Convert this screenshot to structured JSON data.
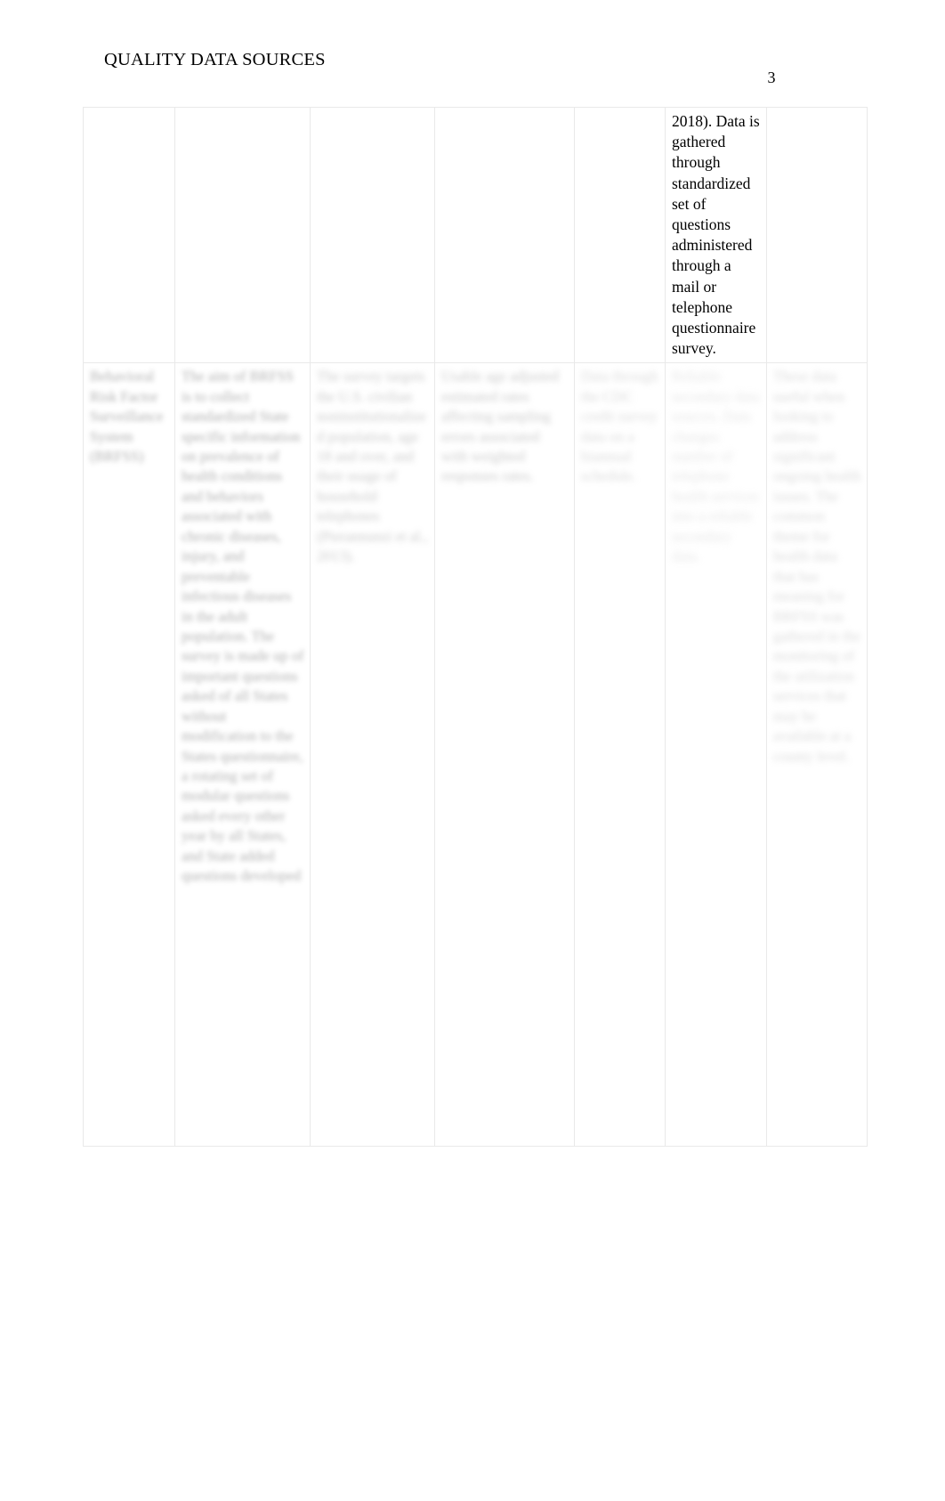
{
  "document": {
    "running_header": "QUALITY DATA SOURCES",
    "page_number": "3"
  },
  "table": {
    "rows": [
      {
        "name": "continuation-row",
        "cells": [
          {
            "name": "cell-r1c1",
            "text": "",
            "state": "empty"
          },
          {
            "name": "cell-r1c2",
            "text": "",
            "state": "empty"
          },
          {
            "name": "cell-r1c3",
            "text": "",
            "state": "empty"
          },
          {
            "name": "cell-r1c4",
            "text": "",
            "state": "empty"
          },
          {
            "name": "cell-r1c5",
            "text": "",
            "state": "empty"
          },
          {
            "name": "cell-r1c6",
            "text": "2018). Data is gathered through standardized set of questions administered through a mail or telephone questionnaire survey.",
            "state": "legible"
          },
          {
            "name": "cell-r1c7",
            "text": "",
            "state": "empty"
          }
        ]
      },
      {
        "name": "main-row",
        "cells": [
          {
            "name": "cell-r2c1",
            "text": "Behavioral Risk Factor Surveillance System (BRFSS)",
            "state": "redacted"
          },
          {
            "name": "cell-r2c2",
            "text": "The aim of BRFSS is to collect standardized State specific information on prevalence of health conditions and behaviors associated with chronic diseases, injury, and preventable infectious diseases in the adult population. The survey is made up of important questions asked of all States without modification to the States questionnaire, a rotating set of modular questions asked every other year by all States, and State added questions developed",
            "state": "redacted"
          },
          {
            "name": "cell-r2c3",
            "text": "The survey targets the U.S. civilian noninstitutionalized population, age 18 and over, and their usage of household telephones (Pierannunzi et al., 2013).",
            "state": "redacted"
          },
          {
            "name": "cell-r2c4",
            "text": "Usable age adjusted estimated rates affecting sampling errors associated with weighted responses rates.",
            "state": "redacted"
          },
          {
            "name": "cell-r2c5",
            "text": "Data through the CDC credit survey data on a biannual schedule.",
            "state": "redacted"
          },
          {
            "name": "cell-r2c6",
            "text": "Reliable secondary data sources. Data changes number of telephone health services into a reliable secondary data.",
            "state": "redacted"
          },
          {
            "name": "cell-r2c7",
            "text": "These data useful when looking to address significant ongoing health issues. The common theme for health data that has meaning for BRFSS was gathered in the monitoring of the utilization services that may be available at a county level.",
            "state": "redacted"
          }
        ]
      }
    ]
  }
}
